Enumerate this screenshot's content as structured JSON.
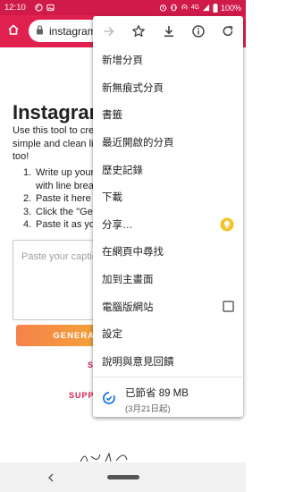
{
  "status_bar": {
    "time": "12:10",
    "network": "4G",
    "battery": "100%",
    "icons": [
      "wifi-calling-icon",
      "photo-icon",
      "alarm-icon",
      "vibrate-icon",
      "hotspot-icon",
      "signal-icon",
      "battery-icon"
    ]
  },
  "toolbar": {
    "url": "instagram",
    "home_icon": "home-icon",
    "lock_icon": "lock-icon"
  },
  "page": {
    "title": "Instagram",
    "intro": "Use this tool to crea simple and clean lin too!",
    "steps": [
      {
        "num": "1.",
        "text": "Write up your c"
      },
      {
        "num": "",
        "text": "with line break"
      },
      {
        "num": "2.",
        "text": "Paste it here"
      },
      {
        "num": "3.",
        "text": "Click the \"Gen"
      },
      {
        "num": "4.",
        "text": "Paste it as you"
      }
    ],
    "caption_placeholder": "Paste your captio",
    "generate_label": "GENERA",
    "link_s": "S",
    "support_label": "SUPPO"
  },
  "menu": {
    "top_icons": [
      "forward-icon",
      "bookmark-star-icon",
      "download-icon",
      "info-icon",
      "refresh-icon"
    ],
    "items": [
      {
        "label": "新增分頁",
        "name": "menu-item-new-tab"
      },
      {
        "label": "新無痕式分頁",
        "name": "menu-item-new-incognito-tab"
      },
      {
        "label": "書籤",
        "name": "menu-item-bookmarks"
      },
      {
        "label": "最近開啟的分頁",
        "name": "menu-item-recent-tabs"
      },
      {
        "label": "歷史記錄",
        "name": "menu-item-history"
      },
      {
        "label": "下載",
        "name": "menu-item-downloads"
      },
      {
        "label": "分享…",
        "name": "menu-item-share"
      },
      {
        "label": "在網頁中尋找",
        "name": "menu-item-find-in-page"
      },
      {
        "label": "加到主畫面",
        "name": "menu-item-add-to-home"
      },
      {
        "label": "電腦版網站",
        "name": "menu-item-desktop-site"
      },
      {
        "label": "設定",
        "name": "menu-item-settings"
      },
      {
        "label": "說明與意見回饋",
        "name": "menu-item-help-feedback"
      }
    ],
    "desktop_site_checked": false,
    "data_saver_main": "已節省 89 MB",
    "data_saver_sub": "(3月21日起)"
  },
  "colors": {
    "brand": "#e0214f",
    "status_bar": "#d01a4a",
    "share_bulb": "#f6c026",
    "data_saver": "#1a73e8"
  }
}
